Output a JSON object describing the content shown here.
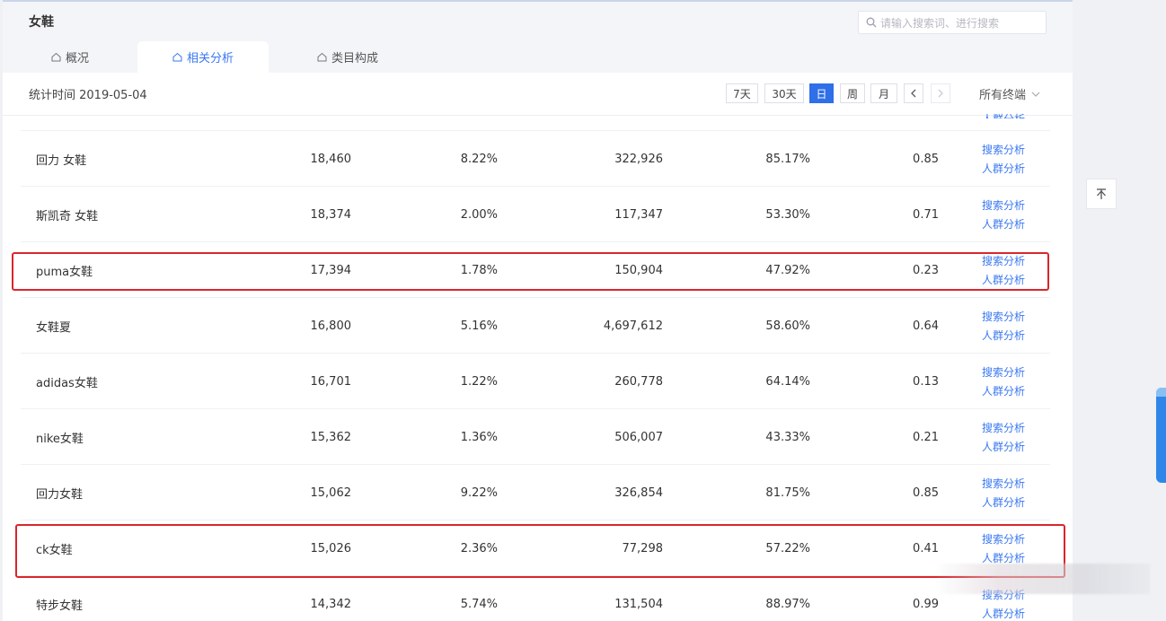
{
  "page": {
    "title": "女鞋"
  },
  "search": {
    "placeholder": "请输入搜索词、进行搜索"
  },
  "tabs": [
    {
      "label": "概况",
      "active": false
    },
    {
      "label": "相关分析",
      "active": true
    },
    {
      "label": "类目构成",
      "active": false
    }
  ],
  "toolbar": {
    "stat_date": "统计时间 2019-05-04",
    "periods": [
      "7天",
      "30天",
      "日",
      "周",
      "月"
    ],
    "active_period": "日",
    "terminal_select": "所有终端"
  },
  "table": {
    "action_search": "搜索分析",
    "action_crowd": "人群分析",
    "rows": [
      {
        "keyword": "回力 女鞋",
        "c1": "18,460",
        "c2": "8.22%",
        "c3": "322,926",
        "c4": "85.17%",
        "c5": "0.85",
        "highlighted": false
      },
      {
        "keyword": "斯凯奇 女鞋",
        "c1": "18,374",
        "c2": "2.00%",
        "c3": "117,347",
        "c4": "53.30%",
        "c5": "0.71",
        "highlighted": false
      },
      {
        "keyword": "puma女鞋",
        "c1": "17,394",
        "c2": "1.78%",
        "c3": "150,904",
        "c4": "47.92%",
        "c5": "0.23",
        "highlighted": true
      },
      {
        "keyword": "女鞋夏",
        "c1": "16,800",
        "c2": "5.16%",
        "c3": "4,697,612",
        "c4": "58.60%",
        "c5": "0.64",
        "highlighted": false
      },
      {
        "keyword": "adidas女鞋",
        "c1": "16,701",
        "c2": "1.22%",
        "c3": "260,778",
        "c4": "64.14%",
        "c5": "0.13",
        "highlighted": false
      },
      {
        "keyword": "nike女鞋",
        "c1": "15,362",
        "c2": "1.36%",
        "c3": "506,007",
        "c4": "43.33%",
        "c5": "0.21",
        "highlighted": false
      },
      {
        "keyword": "回力女鞋",
        "c1": "15,062",
        "c2": "9.22%",
        "c3": "326,854",
        "c4": "81.75%",
        "c5": "0.85",
        "highlighted": false
      },
      {
        "keyword": "ck女鞋",
        "c1": "15,026",
        "c2": "2.36%",
        "c3": "77,298",
        "c4": "57.22%",
        "c5": "0.41",
        "highlighted": true
      },
      {
        "keyword": "特步女鞋",
        "c1": "14,342",
        "c2": "5.74%",
        "c3": "131,504",
        "c4": "88.97%",
        "c5": "0.99",
        "highlighted": false
      }
    ]
  },
  "colors": {
    "accent": "#3a78f2",
    "highlight": "#d9262c",
    "active_period_bg": "#2f6fe8"
  }
}
